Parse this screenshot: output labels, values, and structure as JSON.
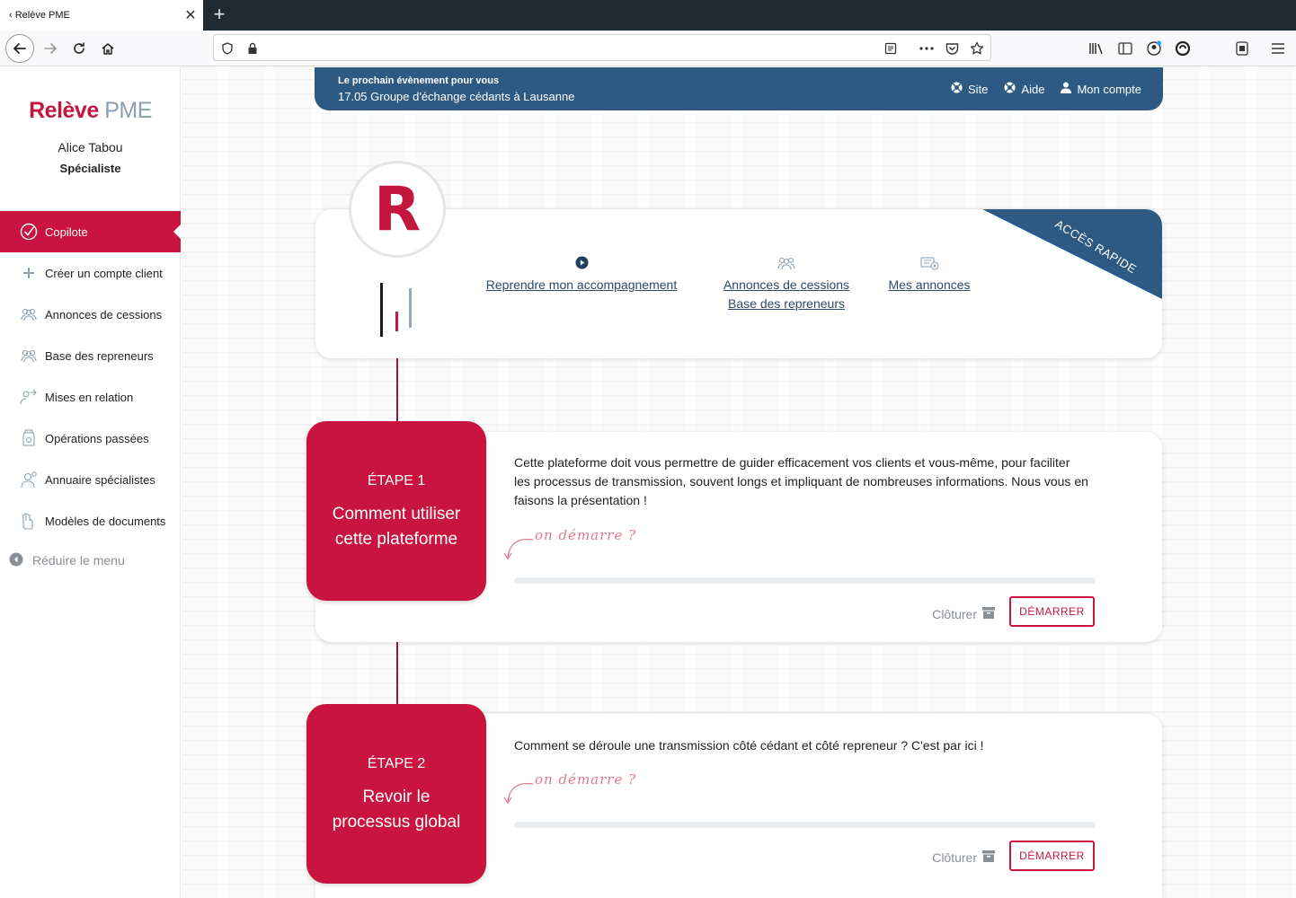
{
  "browser": {
    "tab_title": "‹ Relève PME",
    "tab_close": "✕",
    "new_tab": "+"
  },
  "sidebar": {
    "logo": {
      "part1": "Relève",
      "part2": "PME"
    },
    "user_name": "Alice Tabou",
    "user_role": "Spécialiste",
    "items": [
      {
        "label": "Copilote",
        "icon": "check-circle-icon",
        "active": true
      },
      {
        "label": "Créer un compte client",
        "icon": "plus-icon"
      },
      {
        "label": "Annonces de cessions",
        "icon": "users-group-icon"
      },
      {
        "label": "Base des repreneurs",
        "icon": "users-group-icon"
      },
      {
        "label": "Mises en relation",
        "icon": "people-link-icon"
      },
      {
        "label": "Opérations passées",
        "icon": "jar-icon"
      },
      {
        "label": "Annuaire spécialistes",
        "icon": "specialist-icon"
      },
      {
        "label": "Modèles de documents",
        "icon": "hand-document-icon"
      }
    ],
    "collapse_label": "Réduire le menu"
  },
  "topbar": {
    "event_label": "Le prochain évènement pour vous",
    "event_text": "17.05 Groupe d'échange cédants à Lausanne",
    "links": {
      "site": "Site",
      "aide": "Aide",
      "account": "Mon compte"
    }
  },
  "quick_access": {
    "ribbon": "ACCÈS RAPIDE",
    "logo_letter": "R",
    "links": [
      "Reprendre mon accompagnement",
      "Annonces de cessions",
      "Base des repreneurs",
      "Mes annonces"
    ]
  },
  "steps": [
    {
      "label": "ÉTAPE 1",
      "title_line1": "Comment utiliser",
      "title_line2": "cette plateforme",
      "description": "Cette plateforme doit vous permettre de guider efficacement vos clients et vous-même, pour faciliter les processus de transmission, souvent longs et impliquant de nombreuses informations. Nous vous en faisons la présentation !",
      "hint": "on démarre ?",
      "progress": 0,
      "close_label": "Clôturer",
      "start_label": "DÉMARRER"
    },
    {
      "label": "ÉTAPE 2",
      "title_line1": "Revoir le",
      "title_line2": "processus global",
      "description": "Comment se déroule une transmission côté cédant et côté repreneur ? C'est par ici !",
      "hint": "on démarre ?",
      "progress": 0,
      "close_label": "Clôturer",
      "start_label": "DÉMARRER"
    }
  ],
  "colors": {
    "brand_red": "#c8143f",
    "brand_blue": "#2d5a82",
    "text_dark": "#222222",
    "muted": "#8a8f95"
  }
}
